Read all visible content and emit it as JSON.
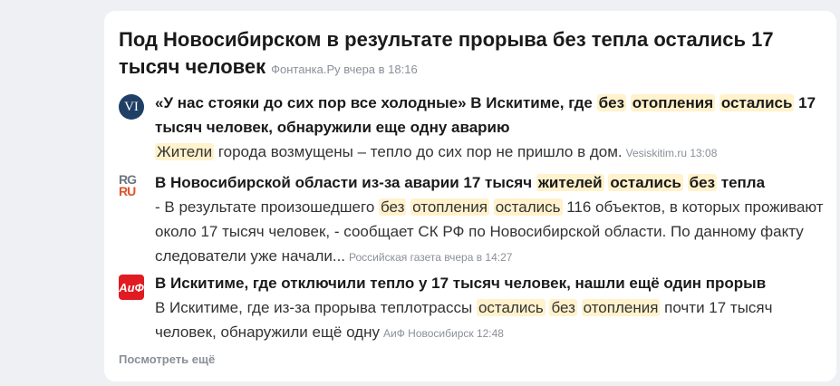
{
  "headline": {
    "title": "Под Новосибирском в результате прорыва без тепла остались 17 тысяч человек",
    "source": "Фонтанка.Ру вчера в 18:16"
  },
  "items": [
    {
      "logo": "VI",
      "title_parts": [
        "«У нас стояки до сих пор все холодные» В Искитиме, где ",
        "без",
        " ",
        "отопления",
        " ",
        "остались",
        " 17 тысяч человек, обнаружили еще одну аварию"
      ],
      "snippet_parts": [
        "Жители",
        " города возмущены – тепло до сих пор не пришло в дом."
      ],
      "meta": "Vesiskitim.ru 13:08"
    },
    {
      "logo_l1": "RG",
      "logo_l2": "RU",
      "title_parts": [
        "В Новосибирской области из-за аварии 17 тысяч ",
        "жителей",
        " ",
        "остались",
        " ",
        "без",
        " тепла"
      ],
      "snippet_parts": [
        "- В результате произошедшего ",
        "без",
        " ",
        "отопления",
        " ",
        "остались",
        " 116 объектов, в которых проживают около 17 тысяч человек, - сообщает СК РФ по Новосибирской области. По данному факту следователи уже начали..."
      ],
      "meta": "Российская газета вчера в 14:27"
    },
    {
      "logo": "АиФ",
      "title_parts": [
        "В Искитиме, где отключили тепло у 17 тысяч человек, нашли ещё один прорыв"
      ],
      "snippet_parts": [
        "В Искитиме, где из-за прорыва теплотрассы ",
        "остались",
        " ",
        "без",
        " ",
        "отопления",
        " почти 17 тысяч человек, обнаружили ещё одну"
      ],
      "meta": "АиФ Новосибирск 12:48"
    }
  ],
  "more_label": "Посмотреть ещё",
  "colors": {
    "highlight": "#fff2cc",
    "muted": "#8a8f98",
    "vi_logo": "#1f3f66",
    "aif_logo": "#e01b22",
    "rg_accent": "#e0532a"
  },
  "icons": [
    "vesiskitim-logo",
    "rg-logo",
    "aif-logo"
  ]
}
